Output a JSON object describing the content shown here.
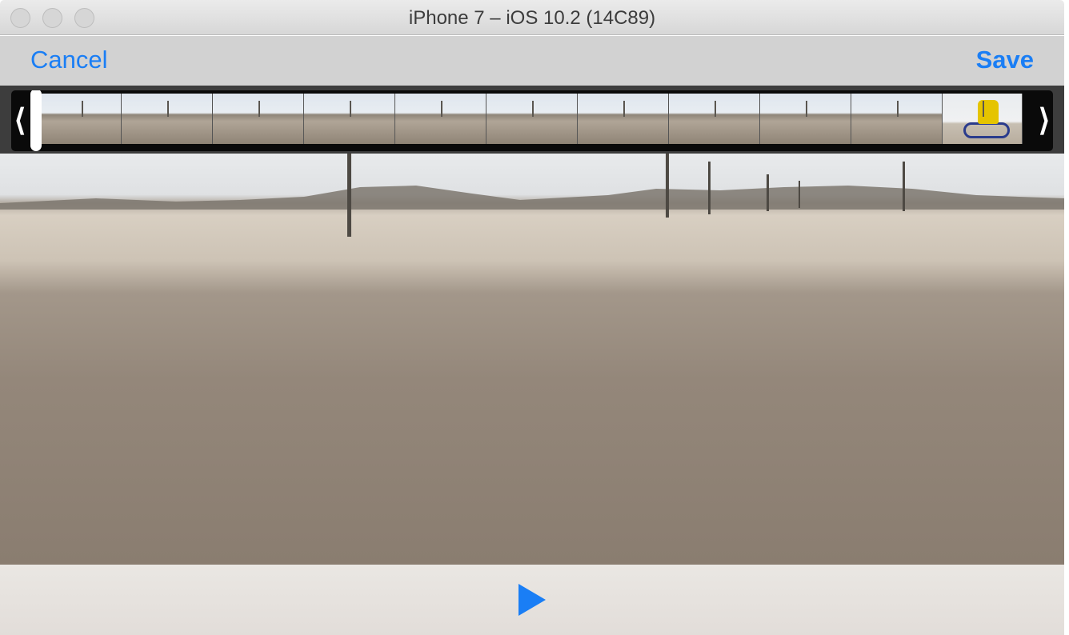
{
  "window": {
    "title": "iPhone 7 – iOS 10.2 (14C89)"
  },
  "navbar": {
    "cancel_label": "Cancel",
    "save_label": "Save"
  },
  "scrubber": {
    "left_handle": "⟨",
    "right_handle": "⟩",
    "frame_count": 12,
    "playhead_position": 0.0
  },
  "toolbar": {
    "play_icon": "play-icon"
  },
  "colors": {
    "accent": "#1a7ef5",
    "navbar_bg": "#d2d2d2",
    "scrubber_bg": "#3d3d3d"
  }
}
